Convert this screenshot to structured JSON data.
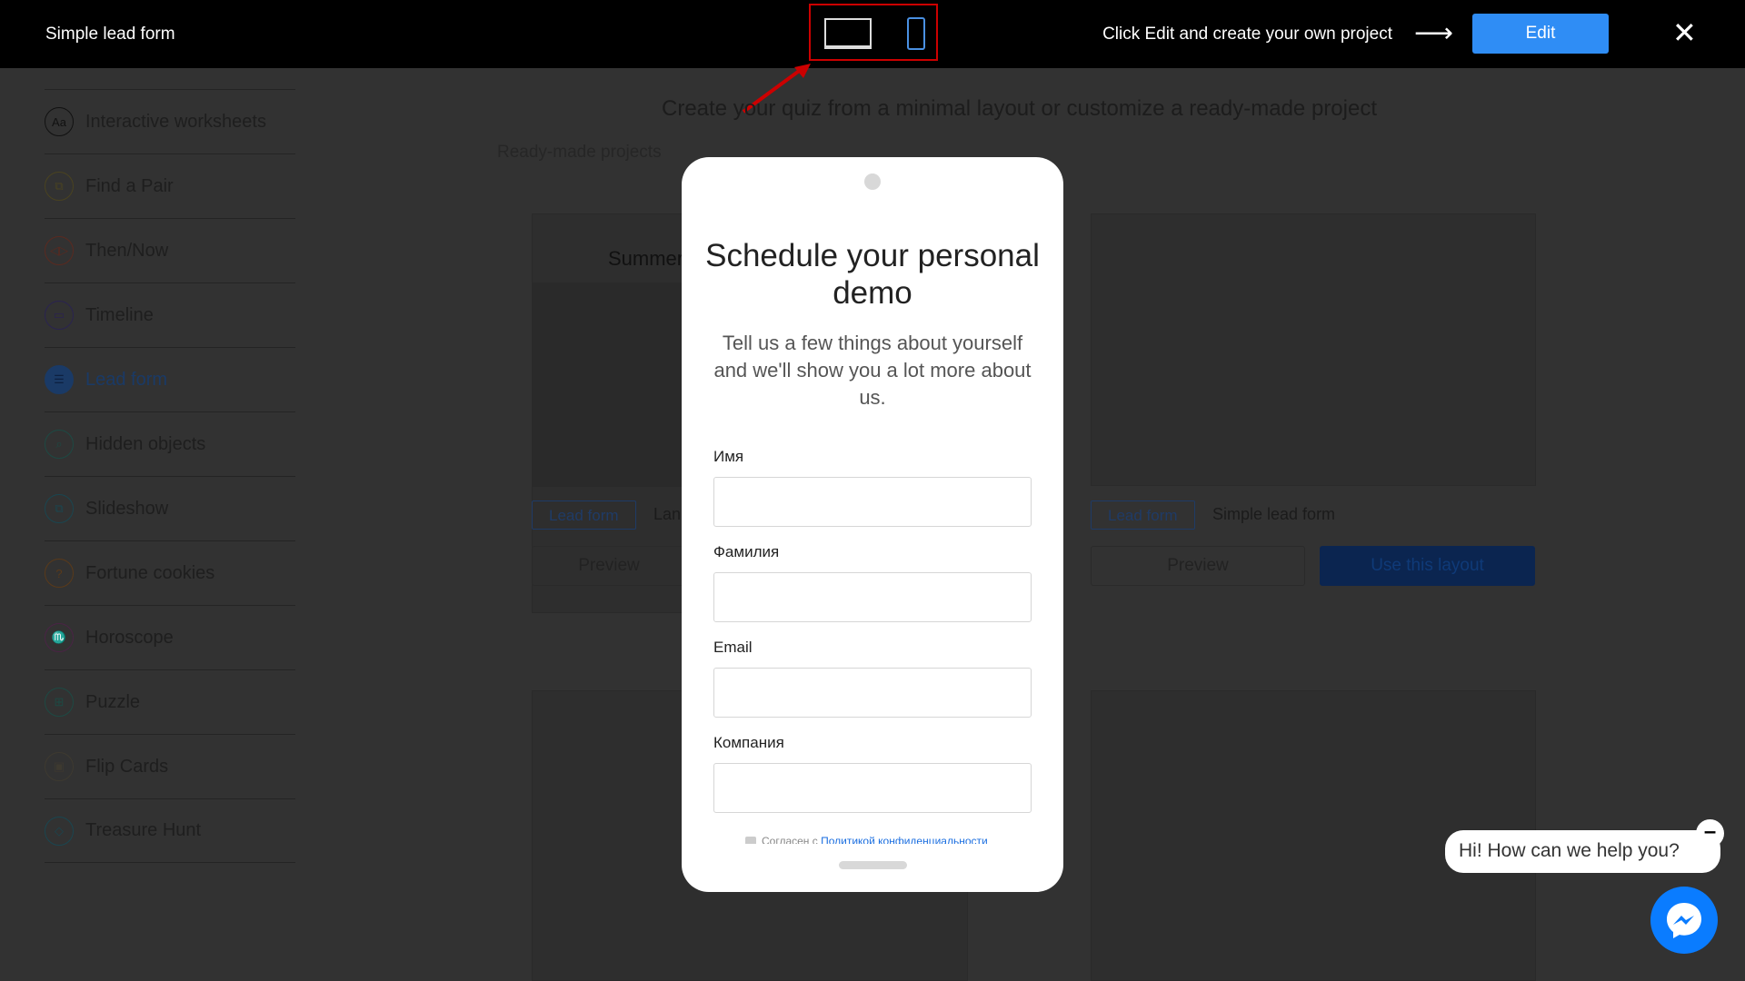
{
  "topbar": {
    "title": "Simple lead form",
    "hint": "Click Edit and create your own project",
    "edit_label": "Edit",
    "close_icon": "close-icon",
    "desktop_icon": "desktop-icon",
    "mobile_icon": "mobile-icon",
    "highlight_color": "#cc0000",
    "accent": "#2f8df5"
  },
  "sidebar": {
    "items": [
      {
        "label": "Interactive worksheets",
        "icon": "Aa",
        "color": "#111111"
      },
      {
        "label": "Find a Pair",
        "icon": "⧉",
        "color": "#4a4320"
      },
      {
        "label": "Then/Now",
        "icon": "◁▷",
        "color": "#5a2a20"
      },
      {
        "label": "Timeline",
        "icon": "▭",
        "color": "#2a2350"
      },
      {
        "label": "Lead form",
        "icon": "☰",
        "color": "#1a3a66"
      },
      {
        "label": "Hidden objects",
        "icon": "⌕",
        "color": "#1d4a44"
      },
      {
        "label": "Slideshow",
        "icon": "⧉",
        "color": "#1a4650"
      },
      {
        "label": "Fortune cookies",
        "icon": "?",
        "color": "#5a3a1a"
      },
      {
        "label": "Horoscope",
        "icon": "♏",
        "color": "#4a2445"
      },
      {
        "label": "Puzzle",
        "icon": "⊞",
        "color": "#1d4a44"
      },
      {
        "label": "Flip Cards",
        "icon": "▣",
        "color": "#3e3a30"
      },
      {
        "label": "Treasure Hunt",
        "icon": "◇",
        "color": "#1a4650"
      }
    ]
  },
  "main": {
    "heading": "Create your quiz from a minimal layout or customize a ready-made project",
    "ready_label": "Ready-made projects",
    "cards": [
      {
        "tag": "Lead form",
        "name": "Lan",
        "preview": "Preview",
        "title": "Summer fi"
      },
      {
        "tag": "Lead form",
        "name": "Simple lead form",
        "preview": "Preview",
        "use": "Use this layout"
      }
    ]
  },
  "modal": {
    "title": "Schedule your personal demo",
    "subtitle": "Tell us a few things about yourself and we'll show you a lot more about us.",
    "fields": [
      {
        "label": "Имя",
        "value": ""
      },
      {
        "label": "Фамилия",
        "value": ""
      },
      {
        "label": "Email",
        "value": ""
      },
      {
        "label": "Компания",
        "value": ""
      }
    ],
    "agree_text": "Согласен с ",
    "agree_link": "Политикой конфиденциальности"
  },
  "chat": {
    "greeting": "Hi! How can we help you?",
    "minimize_icon": "minus-icon",
    "messenger_icon": "messenger-icon",
    "color": "#0a7cff"
  }
}
